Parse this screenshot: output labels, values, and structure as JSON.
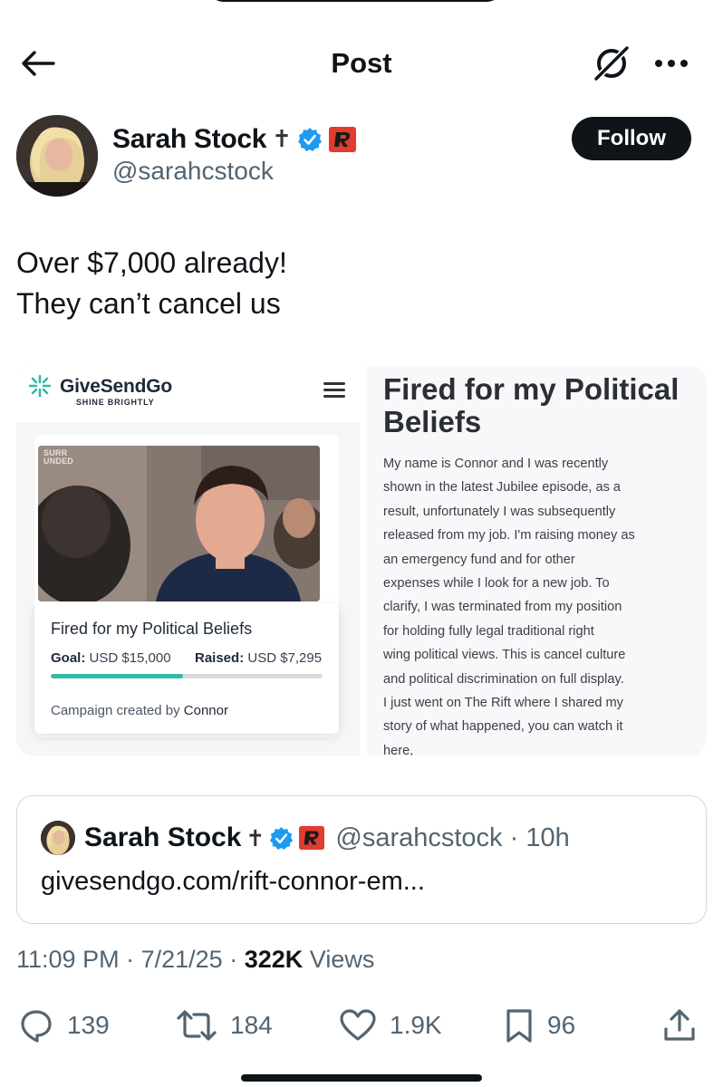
{
  "header": {
    "title": "Post"
  },
  "author": {
    "display_name": "Sarah Stock",
    "name_emoji": "✝",
    "handle": "@sarahcstock",
    "follow_label": "Follow",
    "verified_color": "#1d9bf0"
  },
  "tweet": {
    "lines": [
      "Over $7,000 already!",
      "They can’t cancel us"
    ]
  },
  "media": {
    "site_name": "GiveSendGo",
    "site_tagline": "SHINE BRIGHTLY",
    "photo_logo_line1": "SURR",
    "photo_logo_line2": "UNDED",
    "card_title": "Fired for my Political Beliefs",
    "goal_label": "Goal:",
    "goal_value": "USD $15,000",
    "raised_label": "Raised:",
    "raised_value": "USD $7,295",
    "progress_fraction": 0.486,
    "creator_prefix": "Campaign created by",
    "creator_name": "Connor",
    "story_title": "Fired for my Political Beliefs",
    "story_lines": [
      "My name is Connor and I was recently",
      "shown in the latest Jubilee episode, as a",
      "result, unfortunately I was subsequently",
      "released from my job. I'm raising money as",
      "an emergency fund and for other",
      "expenses while I look for a new job. To",
      "clarify, I was terminated from my position",
      "for holding fully legal traditional right",
      "wing political views. This is cancel culture",
      "and political discrimination on full display.",
      "I just went on The Rift where I shared my",
      "story of what happened, you can watch it",
      "here,"
    ],
    "accent_color": "#33b9a5"
  },
  "quote": {
    "display_name": "Sarah Stock",
    "name_emoji": "✝",
    "handle": "@sarahcstock",
    "separator": "·",
    "time": "10h",
    "text": "givesendgo.com/rift-connor-em..."
  },
  "meta": {
    "time": "11:09 PM",
    "date": "7/21/25",
    "views_count": "322K",
    "views_label": "Views",
    "separator": "·"
  },
  "actions": {
    "replies": "139",
    "reposts": "184",
    "likes": "1.9K",
    "bookmarks": "96"
  }
}
